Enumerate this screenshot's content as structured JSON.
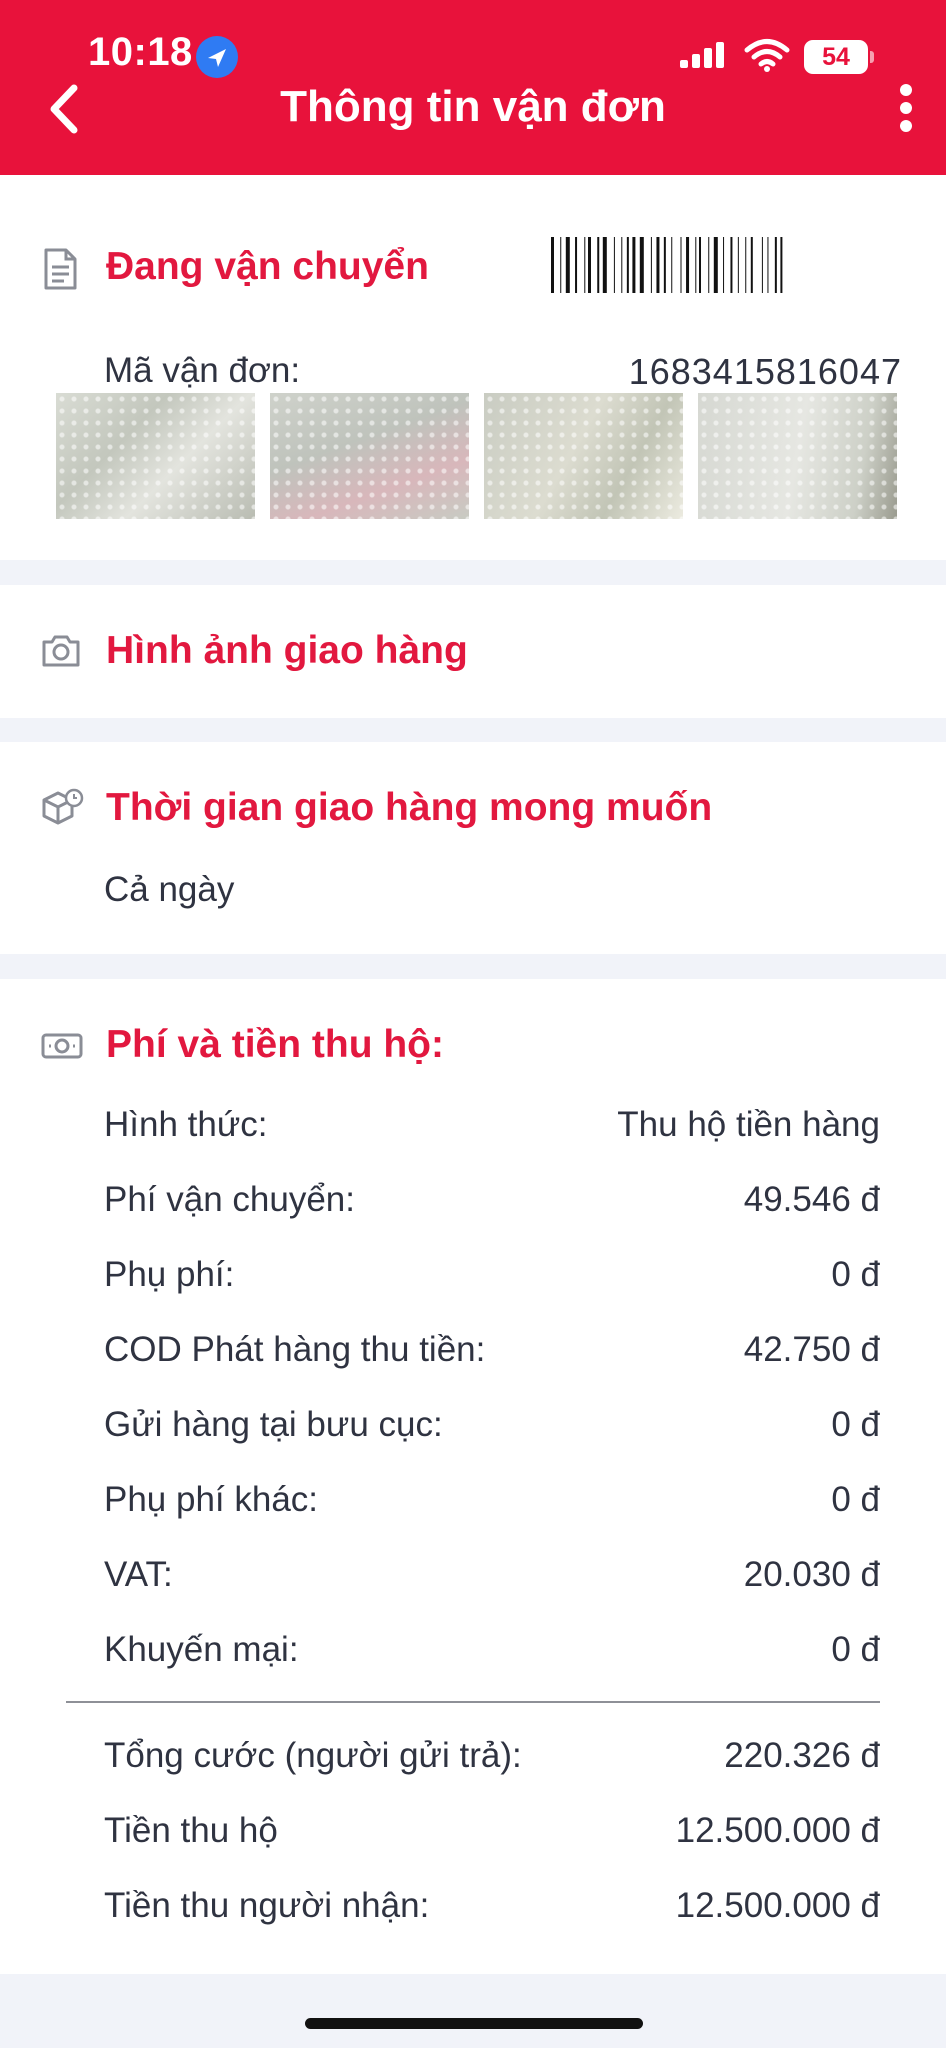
{
  "status_bar": {
    "time": "10:18",
    "battery": "54"
  },
  "header": {
    "title": "Thông tin vận đơn"
  },
  "shipment": {
    "status": "Đang vận chuyển",
    "waybill_label": "Mã vận đơn:",
    "waybill_number": "1683415816047"
  },
  "delivery_images": {
    "title": "Hình ảnh giao hàng"
  },
  "delivery_time": {
    "title": "Thời gian giao hàng mong muốn",
    "value": "Cả ngày"
  },
  "fees": {
    "title": "Phí và tiền thu hộ:",
    "rows": [
      {
        "label": "Hình thức:",
        "value": "Thu hộ tiền hàng"
      },
      {
        "label": "Phí vận chuyển:",
        "value": "49.546 đ"
      },
      {
        "label": "Phụ phí:",
        "value": "0 đ"
      },
      {
        "label": "COD Phát hàng thu tiền:",
        "value": "42.750 đ"
      },
      {
        "label": "Gửi hàng tại bưu cục:",
        "value": "0 đ"
      },
      {
        "label": "Phụ phí khác:",
        "value": "0 đ"
      },
      {
        "label": "VAT:",
        "value": "20.030 đ"
      },
      {
        "label": "Khuyến mại:",
        "value": "0 đ"
      }
    ],
    "totals": [
      {
        "label": "Tổng cước (người gửi trả):",
        "value": "220.326 đ"
      },
      {
        "label": "Tiền thu hộ",
        "value": "12.500.000 đ"
      },
      {
        "label": "Tiền thu người nhận:",
        "value": "12.500.000 đ"
      }
    ]
  },
  "colors": {
    "brand": "#e8123b",
    "section_title": "#e2183f"
  }
}
